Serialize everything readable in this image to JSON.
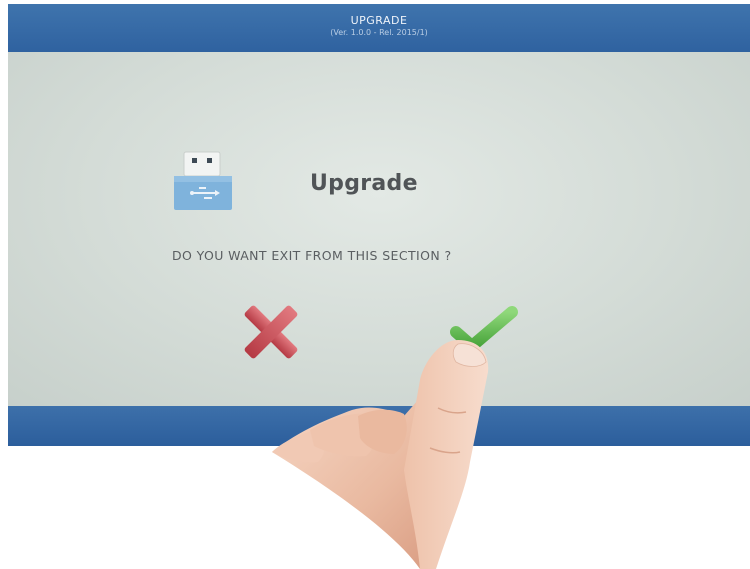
{
  "header": {
    "title": "UPGRADE",
    "subtitle": "(Ver. 1.0.0 - Rel. 2015/1)"
  },
  "dialog": {
    "icon": "usb-drive-icon",
    "title": "Upgrade",
    "message": "DO YOU WANT EXIT FROM THIS SECTION ?",
    "cancel_icon": "cross-icon",
    "confirm_icon": "checkmark-icon"
  },
  "colors": {
    "header_bar": "#3469a5",
    "screen_background": "#d4dcd6",
    "cancel": "#c9454f",
    "confirm": "#5dbb4e",
    "text": "#505457"
  }
}
